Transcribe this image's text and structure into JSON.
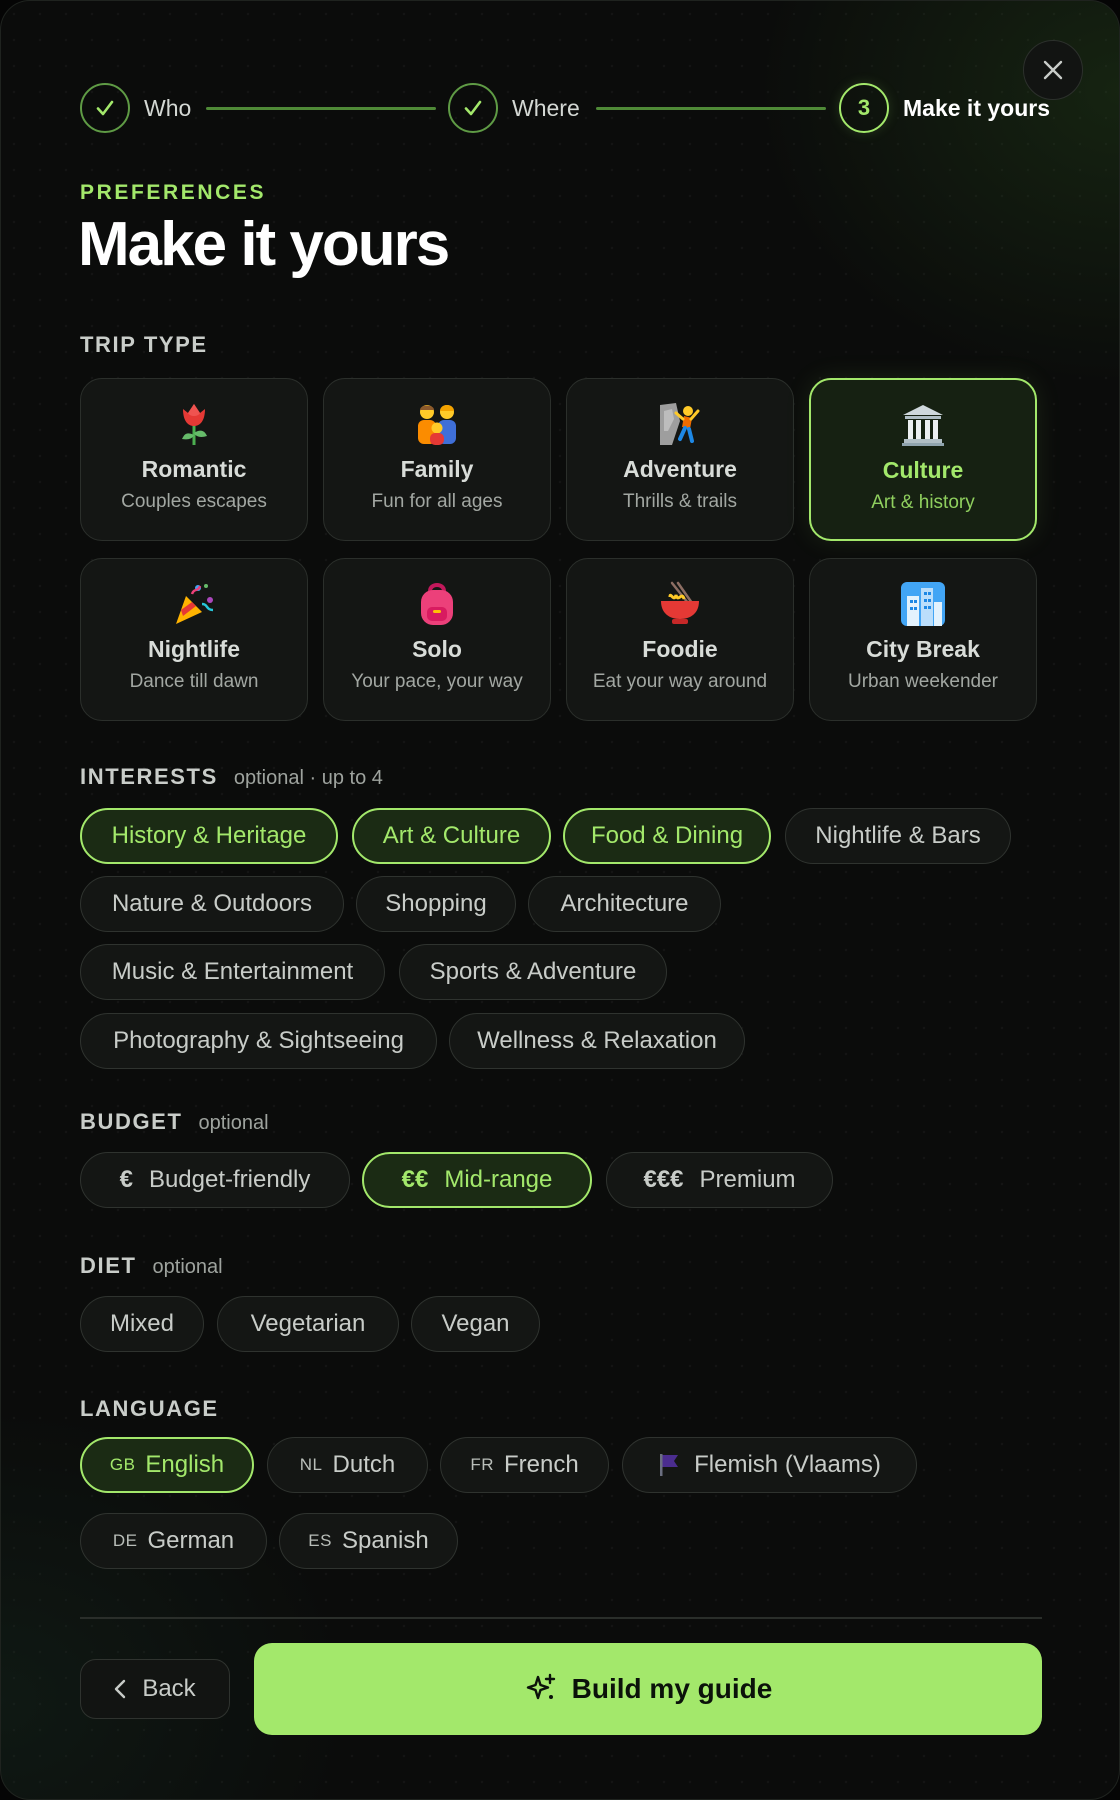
{
  "stepper": {
    "steps": [
      {
        "label": "Who",
        "state": "done"
      },
      {
        "label": "Where",
        "state": "done"
      },
      {
        "number": "3",
        "label": "Make it yours",
        "state": "active"
      }
    ]
  },
  "header": {
    "eyebrow": "PREFERENCES",
    "title": "Make it yours"
  },
  "trip_type": {
    "label": "TRIP TYPE",
    "selected": "Culture",
    "options": [
      {
        "title": "Romantic",
        "subtitle": "Couples escapes",
        "icon": "rose-icon"
      },
      {
        "title": "Family",
        "subtitle": "Fun for all ages",
        "icon": "family-icon"
      },
      {
        "title": "Adventure",
        "subtitle": "Thrills & trails",
        "icon": "climber-icon"
      },
      {
        "title": "Culture",
        "subtitle": "Art & history",
        "icon": "museum-icon"
      },
      {
        "title": "Nightlife",
        "subtitle": "Dance till dawn",
        "icon": "party-popper-icon"
      },
      {
        "title": "Solo",
        "subtitle": "Your pace, your way",
        "icon": "backpack-icon"
      },
      {
        "title": "Foodie",
        "subtitle": "Eat your way around",
        "icon": "noodle-bowl-icon"
      },
      {
        "title": "City Break",
        "subtitle": "Urban weekender",
        "icon": "city-icon"
      }
    ]
  },
  "interests": {
    "label": "INTERESTS",
    "hint": "optional · up to 4",
    "options": [
      {
        "label": "History & Heritage",
        "selected": true
      },
      {
        "label": "Art & Culture",
        "selected": true
      },
      {
        "label": "Food & Dining",
        "selected": true
      },
      {
        "label": "Nightlife & Bars",
        "selected": false
      },
      {
        "label": "Nature & Outdoors",
        "selected": false
      },
      {
        "label": "Shopping",
        "selected": false
      },
      {
        "label": "Architecture",
        "selected": false
      },
      {
        "label": "Music & Entertainment",
        "selected": false
      },
      {
        "label": "Sports & Adventure",
        "selected": false
      },
      {
        "label": "Photography & Sightseeing",
        "selected": false
      },
      {
        "label": "Wellness & Relaxation",
        "selected": false
      }
    ]
  },
  "budget": {
    "label": "BUDGET",
    "hint": "optional",
    "options": [
      {
        "symbol": "€",
        "label": "Budget-friendly",
        "selected": false
      },
      {
        "symbol": "€€",
        "label": "Mid-range",
        "selected": true
      },
      {
        "symbol": "€€€",
        "label": "Premium",
        "selected": false
      }
    ]
  },
  "diet": {
    "label": "DIET",
    "hint": "optional",
    "options": [
      {
        "label": "Mixed",
        "selected": false
      },
      {
        "label": "Vegetarian",
        "selected": false
      },
      {
        "label": "Vegan",
        "selected": false
      }
    ]
  },
  "language": {
    "label": "LANGUAGE",
    "options": [
      {
        "code": "GB",
        "label": "English",
        "selected": true
      },
      {
        "code": "NL",
        "label": "Dutch",
        "selected": false
      },
      {
        "code": "FR",
        "label": "French",
        "selected": false
      },
      {
        "icon": "flag-icon",
        "label": "Flemish (Vlaams)",
        "selected": false
      },
      {
        "code": "DE",
        "label": "German",
        "selected": false
      },
      {
        "code": "ES",
        "label": "Spanish",
        "selected": false
      }
    ]
  },
  "footer": {
    "back_label": "Back",
    "build_label": "Build my guide"
  },
  "colors": {
    "accent": "#a3e86b",
    "background": "#0b0c0b",
    "chip_border": "#2f332f"
  }
}
